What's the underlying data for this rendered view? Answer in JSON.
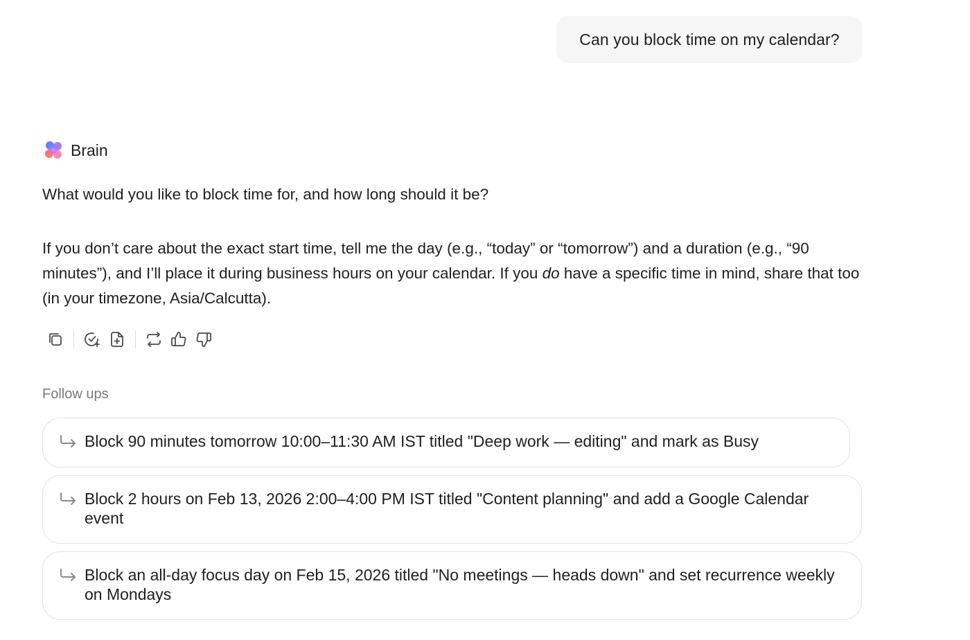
{
  "user_message": "Can you block time on my calendar?",
  "assistant": {
    "name": "Brain",
    "question": "What would you like to block time for, and how long should it be?",
    "detail_part1": "If you don’t care about the exact start time, tell me the day (e.g., “today” or “tomorrow”) and a duration (e.g., “90 minutes”), and I’ll place it during business hours on your calendar. If you ",
    "detail_emphasis": "do",
    "detail_part2": " have a specific time in mind, share that too (in your timezone, Asia/Calcutta)."
  },
  "toolbar": {
    "icons": [
      "copy-icon",
      "check-add-icon",
      "new-doc-icon",
      "regenerate-icon",
      "thumbs-up-icon",
      "thumbs-down-icon"
    ]
  },
  "followups": {
    "label": "Follow ups",
    "items": [
      "Block 90 minutes tomorrow 10:00–11:30 AM IST titled \"Deep work — editing\" and mark as Busy",
      "Block 2 hours on Feb 13, 2026 2:00–4:00 PM IST titled \"Content planning\" and add a Google Calendar event",
      "Block an all-day focus day on Feb 15, 2026 titled \"No meetings — heads down\" and set recurrence weekly on Mondays"
    ]
  },
  "colors": {
    "text": "#1f1f1f",
    "muted": "#7a7a7a",
    "bubble": "#f6f6f6",
    "border": "#e3e3e3"
  }
}
